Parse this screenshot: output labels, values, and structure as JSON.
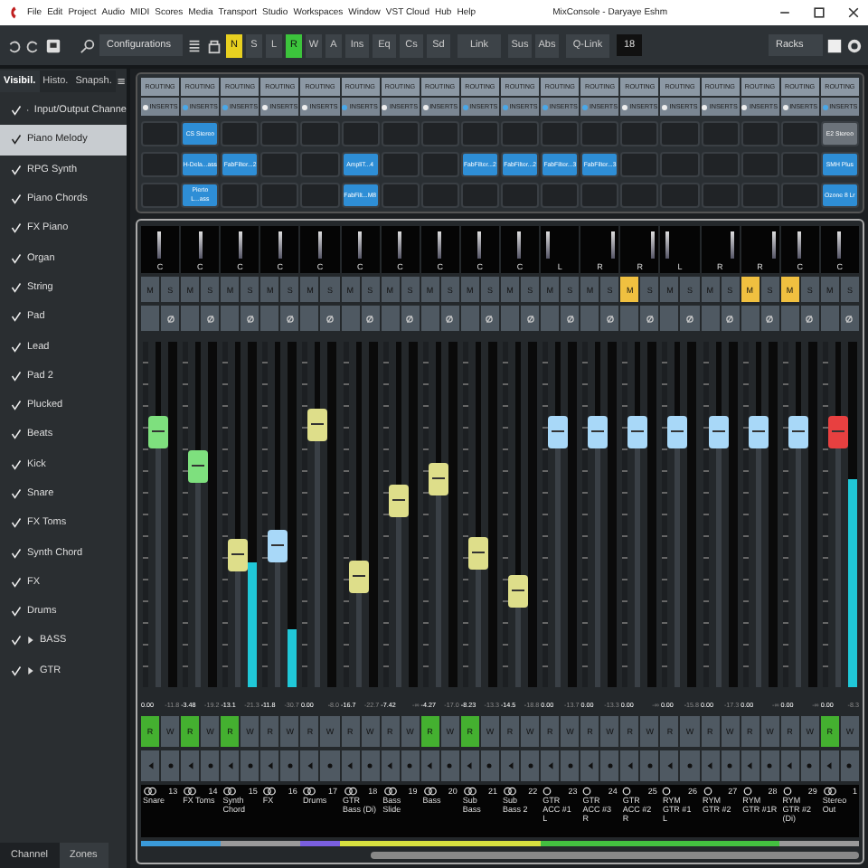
{
  "menu": {
    "items": [
      "File",
      "Edit",
      "Project",
      "Audio",
      "MIDI",
      "Scores",
      "Media",
      "Transport",
      "Studio",
      "Workspaces",
      "Window",
      "VST Cloud",
      "Hub",
      "Help"
    ],
    "title": "MixConsole - Daryaye Eshm"
  },
  "toolbar": {
    "configurations": "Configurations",
    "states": [
      {
        "label": "N",
        "on": true,
        "color": "#e8d020"
      },
      {
        "label": "S",
        "on": false
      },
      {
        "label": "L",
        "on": false
      },
      {
        "label": "R",
        "on": true,
        "color": "#3cc43c"
      },
      {
        "label": "W",
        "on": false
      },
      {
        "label": "A",
        "on": false
      }
    ],
    "sections": [
      "Ins",
      "Eq",
      "Cs",
      "Sd"
    ],
    "link": "Link",
    "modes": [
      "Sus",
      "Abs"
    ],
    "qlink": "Q-Link",
    "count": "18",
    "racks": "Racks"
  },
  "sidebar": {
    "tabs": [
      {
        "label": "Visibil.",
        "selected": true
      },
      {
        "label": "Histo.",
        "selected": false
      },
      {
        "label": "Snapsh.",
        "selected": false
      }
    ],
    "items": [
      {
        "label": "Input/Output Channe",
        "checked": true,
        "selected": false,
        "kind": "folder"
      },
      {
        "label": "Piano Melody",
        "checked": true,
        "selected": true,
        "kind": "track"
      },
      {
        "label": "RPG Synth",
        "checked": true,
        "selected": false,
        "kind": "track"
      },
      {
        "label": "Piano Chords",
        "checked": true,
        "selected": false,
        "kind": "track"
      },
      {
        "label": "FX Piano",
        "checked": true,
        "selected": false,
        "kind": "track"
      },
      {
        "label": "Organ",
        "checked": true,
        "selected": false,
        "kind": "track"
      },
      {
        "label": "String",
        "checked": true,
        "selected": false,
        "kind": "track"
      },
      {
        "label": "Pad",
        "checked": true,
        "selected": false,
        "kind": "track"
      },
      {
        "label": "Lead",
        "checked": true,
        "selected": false,
        "kind": "track"
      },
      {
        "label": "Pad 2",
        "checked": true,
        "selected": false,
        "kind": "track"
      },
      {
        "label": "Plucked",
        "checked": true,
        "selected": false,
        "kind": "track"
      },
      {
        "label": "Beats",
        "checked": true,
        "selected": false,
        "kind": "track"
      },
      {
        "label": "Kick",
        "checked": true,
        "selected": false,
        "kind": "track"
      },
      {
        "label": "Snare",
        "checked": true,
        "selected": false,
        "kind": "track"
      },
      {
        "label": "FX Toms",
        "checked": true,
        "selected": false,
        "kind": "track"
      },
      {
        "label": "Synth Chord",
        "checked": true,
        "selected": false,
        "kind": "track"
      },
      {
        "label": "FX",
        "checked": true,
        "selected": false,
        "kind": "track"
      },
      {
        "label": "Drums",
        "checked": true,
        "selected": false,
        "kind": "track"
      },
      {
        "label": "BASS",
        "checked": true,
        "selected": false,
        "kind": "folder"
      },
      {
        "label": "GTR",
        "checked": true,
        "selected": false,
        "kind": "folder"
      }
    ],
    "bottom_tabs": [
      {
        "label": "Channel",
        "selected": false
      },
      {
        "label": "Zones",
        "selected": true
      }
    ]
  },
  "channels": [
    {
      "routing": "ROUTING",
      "inserts_label": "INSERTS",
      "inserts": [
        {
          "kind": "empty"
        },
        {
          "kind": "empty"
        },
        {
          "kind": "empty"
        }
      ],
      "pan": {
        "label": "C",
        "kind": "center"
      },
      "mute": {
        "label": "M",
        "on": false
      },
      "solo": {
        "label": "S"
      },
      "read": {
        "label": "R",
        "on": true
      },
      "write": {
        "label": "W"
      },
      "fader": {
        "level": 0.74,
        "color": "#7ee07e"
      },
      "value": "0.00",
      "peak": "-11.8",
      "stereo": true,
      "number": "13",
      "name": "Snare",
      "color": "#3a9ad9"
    },
    {
      "routing": "ROUTING",
      "inserts_label": "INSERTS",
      "inserts": [
        {
          "kind": "plugin",
          "name": "CS Stereo",
          "bypassed": false
        },
        {
          "kind": "plugin",
          "name": "H-Dela...ass",
          "bypassed": false
        },
        {
          "kind": "plugin",
          "name": "Pierto L...ass",
          "bypassed": false
        }
      ],
      "pan": {
        "label": "C",
        "kind": "center"
      },
      "mute": {
        "label": "M",
        "on": false
      },
      "solo": {
        "label": "S"
      },
      "read": {
        "label": "R",
        "on": true
      },
      "write": {
        "label": "W"
      },
      "fader": {
        "level": 0.64,
        "color": "#7ee07e"
      },
      "value": "-3.48",
      "peak": "-19.2",
      "stereo": true,
      "number": "14",
      "name": "FX Toms",
      "color": "#3a9ad9"
    },
    {
      "routing": "ROUTING",
      "inserts_label": "INSERTS",
      "inserts": [
        {
          "kind": "empty"
        },
        {
          "kind": "plugin",
          "name": "FabFilter...2",
          "bypassed": false
        },
        {
          "kind": "empty"
        }
      ],
      "pan": {
        "label": "C",
        "kind": "center"
      },
      "mute": {
        "label": "M",
        "on": false
      },
      "solo": {
        "label": "S"
      },
      "read": {
        "label": "R",
        "on": true
      },
      "write": {
        "label": "W"
      },
      "fader": {
        "level": 0.38,
        "color": "#dede8a"
      },
      "meter": {
        "level": 0.36
      },
      "value": "-13.1",
      "peak": "-21.3",
      "stereo": true,
      "number": "15",
      "name": "Synth Chord",
      "color": "#9a9a9a"
    },
    {
      "routing": "ROUTING",
      "inserts_label": "INSERTS",
      "inserts": [
        {
          "kind": "empty"
        },
        {
          "kind": "empty"
        },
        {
          "kind": "empty"
        }
      ],
      "pan": {
        "label": "C",
        "kind": "center"
      },
      "mute": {
        "label": "M",
        "on": false
      },
      "solo": {
        "label": "S"
      },
      "read": {
        "label": "R",
        "on": false
      },
      "write": {
        "label": "W"
      },
      "fader": {
        "level": 0.41,
        "color": "#a8d8f8"
      },
      "meter": {
        "level": 0.17
      },
      "value": "-11.8",
      "peak": "-30.7",
      "stereo": true,
      "number": "16",
      "name": "FX",
      "color": "#9a9a9a"
    },
    {
      "routing": "ROUTING",
      "inserts_label": "INSERTS",
      "inserts": [
        {
          "kind": "empty"
        },
        {
          "kind": "empty"
        },
        {
          "kind": "empty"
        }
      ],
      "pan": {
        "label": "C",
        "kind": "center"
      },
      "mute": {
        "label": "M",
        "on": false
      },
      "solo": {
        "label": "S"
      },
      "read": {
        "label": "R",
        "on": false
      },
      "write": {
        "label": "W"
      },
      "fader": {
        "level": 0.76,
        "color": "#dede8a"
      },
      "value": "0.00",
      "peak": "-8.0",
      "stereo": true,
      "number": "17",
      "name": "Drums",
      "color": "#7a5fe0"
    },
    {
      "routing": "ROUTING",
      "inserts_label": "INSERTS",
      "inserts": [
        {
          "kind": "empty"
        },
        {
          "kind": "plugin",
          "name": "AmpliT...4",
          "bypassed": false
        },
        {
          "kind": "plugin",
          "name": "FabFilt...M8",
          "bypassed": false
        }
      ],
      "pan": {
        "label": "C",
        "kind": "center"
      },
      "mute": {
        "label": "M",
        "on": false
      },
      "solo": {
        "label": "S"
      },
      "read": {
        "label": "R",
        "on": false
      },
      "write": {
        "label": "W"
      },
      "fader": {
        "level": 0.32,
        "color": "#dede8a"
      },
      "value": "-16.7",
      "peak": "-22.7",
      "stereo": true,
      "number": "18",
      "name": "GTR Bass (Di)",
      "color": "#d8e040"
    },
    {
      "routing": "ROUTING",
      "inserts_label": "INSERTS",
      "inserts": [
        {
          "kind": "empty"
        },
        {
          "kind": "empty"
        },
        {
          "kind": "empty"
        }
      ],
      "pan": {
        "label": "C",
        "kind": "center"
      },
      "mute": {
        "label": "M",
        "on": false
      },
      "solo": {
        "label": "S"
      },
      "read": {
        "label": "R",
        "on": false
      },
      "write": {
        "label": "W"
      },
      "fader": {
        "level": 0.54,
        "color": "#dede8a"
      },
      "value": "-7.42",
      "peak": "-∞",
      "stereo": true,
      "number": "19",
      "name": "Bass Slide",
      "color": "#d8e040"
    },
    {
      "routing": "ROUTING",
      "inserts_label": "INSERTS",
      "inserts": [
        {
          "kind": "empty"
        },
        {
          "kind": "empty"
        },
        {
          "kind": "empty"
        }
      ],
      "pan": {
        "label": "C",
        "kind": "center"
      },
      "mute": {
        "label": "M",
        "on": false
      },
      "solo": {
        "label": "S"
      },
      "read": {
        "label": "R",
        "on": true
      },
      "write": {
        "label": "W"
      },
      "fader": {
        "level": 0.6,
        "color": "#dede8a"
      },
      "value": "-4.27",
      "peak": "-17.0",
      "stereo": true,
      "number": "20",
      "name": "Bass",
      "color": "#d8e040"
    },
    {
      "routing": "ROUTING",
      "inserts_label": "INSERTS",
      "inserts": [
        {
          "kind": "empty"
        },
        {
          "kind": "plugin",
          "name": "FabFilter...2",
          "bypassed": false
        },
        {
          "kind": "empty"
        }
      ],
      "pan": {
        "label": "C",
        "kind": "center"
      },
      "mute": {
        "label": "M",
        "on": false
      },
      "solo": {
        "label": "S"
      },
      "read": {
        "label": "R",
        "on": true
      },
      "write": {
        "label": "W"
      },
      "fader": {
        "level": 0.39,
        "color": "#dede8a"
      },
      "value": "-8.23",
      "peak": "-13.3",
      "stereo": true,
      "number": "21",
      "name": "Sub Bass",
      "color": "#d8e040"
    },
    {
      "routing": "ROUTING",
      "inserts_label": "INSERTS",
      "inserts": [
        {
          "kind": "empty"
        },
        {
          "kind": "plugin",
          "name": "FabFilter...2",
          "bypassed": false
        },
        {
          "kind": "empty"
        }
      ],
      "pan": {
        "label": "C",
        "kind": "center"
      },
      "mute": {
        "label": "M",
        "on": false
      },
      "solo": {
        "label": "S"
      },
      "read": {
        "label": "R",
        "on": false
      },
      "write": {
        "label": "W"
      },
      "fader": {
        "level": 0.28,
        "color": "#dede8a"
      },
      "value": "-14.5",
      "peak": "-18.8",
      "stereo": true,
      "number": "22",
      "name": "Sub Bass 2",
      "color": "#d8e040"
    },
    {
      "routing": "ROUTING",
      "inserts_label": "INSERTS",
      "inserts": [
        {
          "kind": "empty"
        },
        {
          "kind": "plugin",
          "name": "FabFilter...3",
          "bypassed": false
        },
        {
          "kind": "empty"
        }
      ],
      "pan": {
        "label": "L",
        "kind": "left"
      },
      "mute": {
        "label": "M",
        "on": false
      },
      "solo": {
        "label": "S"
      },
      "read": {
        "label": "R",
        "on": false
      },
      "write": {
        "label": "W"
      },
      "fader": {
        "level": 0.74,
        "color": "#a8d8f8"
      },
      "value": "0.00",
      "peak": "-13.7",
      "stereo": false,
      "number": "23",
      "name": "GTR ACC #1 L",
      "color": "#44c040"
    },
    {
      "routing": "ROUTING",
      "inserts_label": "INSERTS",
      "inserts": [
        {
          "kind": "empty"
        },
        {
          "kind": "plugin",
          "name": "FabFilter...3",
          "bypassed": false
        },
        {
          "kind": "empty"
        }
      ],
      "pan": {
        "label": "R",
        "kind": "right"
      },
      "mute": {
        "label": "M",
        "on": false
      },
      "solo": {
        "label": "S"
      },
      "read": {
        "label": "R",
        "on": false
      },
      "write": {
        "label": "W"
      },
      "fader": {
        "level": 0.74,
        "color": "#a8d8f8"
      },
      "value": "0.00",
      "peak": "-13.3",
      "stereo": false,
      "number": "24",
      "name": "GTR ACC #3 R",
      "color": "#44c040"
    },
    {
      "routing": "ROUTING",
      "inserts_label": "INSERTS",
      "inserts": [
        {
          "kind": "empty"
        },
        {
          "kind": "empty"
        },
        {
          "kind": "empty"
        }
      ],
      "pan": {
        "label": "R",
        "kind": "right"
      },
      "mute": {
        "label": "M",
        "on": true
      },
      "solo": {
        "label": "S"
      },
      "read": {
        "label": "R",
        "on": false
      },
      "write": {
        "label": "W"
      },
      "fader": {
        "level": 0.74,
        "color": "#a8d8f8"
      },
      "value": "0.00",
      "peak": "-∞",
      "stereo": false,
      "number": "25",
      "name": "GTR ACC #2 R",
      "color": "#44c040"
    },
    {
      "routing": "ROUTING",
      "inserts_label": "INSERTS",
      "inserts": [
        {
          "kind": "empty"
        },
        {
          "kind": "empty"
        },
        {
          "kind": "empty"
        }
      ],
      "pan": {
        "label": "L",
        "kind": "left"
      },
      "mute": {
        "label": "M",
        "on": false
      },
      "solo": {
        "label": "S"
      },
      "read": {
        "label": "R",
        "on": false
      },
      "write": {
        "label": "W"
      },
      "fader": {
        "level": 0.74,
        "color": "#a8d8f8"
      },
      "value": "0.00",
      "peak": "-15.8",
      "stereo": false,
      "number": "26",
      "name": "RYM GTR #1 L",
      "color": "#44c040"
    },
    {
      "routing": "ROUTING",
      "inserts_label": "INSERTS",
      "inserts": [
        {
          "kind": "empty"
        },
        {
          "kind": "empty"
        },
        {
          "kind": "empty"
        }
      ],
      "pan": {
        "label": "R",
        "kind": "right"
      },
      "mute": {
        "label": "M",
        "on": false
      },
      "solo": {
        "label": "S"
      },
      "read": {
        "label": "R",
        "on": false
      },
      "write": {
        "label": "W"
      },
      "fader": {
        "level": 0.74,
        "color": "#a8d8f8"
      },
      "value": "0.00",
      "peak": "-17.3",
      "stereo": false,
      "number": "27",
      "name": "RYM GTR #2",
      "color": "#44c040"
    },
    {
      "routing": "ROUTING",
      "inserts_label": "INSERTS",
      "inserts": [
        {
          "kind": "empty"
        },
        {
          "kind": "empty"
        },
        {
          "kind": "empty"
        }
      ],
      "pan": {
        "label": "R",
        "kind": "right"
      },
      "mute": {
        "label": "M",
        "on": true
      },
      "solo": {
        "label": "S"
      },
      "read": {
        "label": "R",
        "on": false
      },
      "write": {
        "label": "W"
      },
      "fader": {
        "level": 0.74,
        "color": "#a8d8f8"
      },
      "value": "0.00",
      "peak": "-∞",
      "stereo": false,
      "number": "28",
      "name": "RYM GTR #1R",
      "color": "#44c040"
    },
    {
      "routing": "ROUTING",
      "inserts_label": "INSERTS",
      "inserts": [
        {
          "kind": "empty"
        },
        {
          "kind": "empty"
        },
        {
          "kind": "empty"
        }
      ],
      "pan": {
        "label": "C",
        "kind": "center"
      },
      "mute": {
        "label": "M",
        "on": true
      },
      "solo": {
        "label": "S"
      },
      "read": {
        "label": "R",
        "on": false
      },
      "write": {
        "label": "W"
      },
      "fader": {
        "level": 0.74,
        "color": "#a8d8f8"
      },
      "value": "0.00",
      "peak": "-∞",
      "stereo": false,
      "number": "29",
      "name": "RYM GTR #2 (Di)",
      "color": "#9a9a9a"
    },
    {
      "routing": "ROUTING",
      "inserts_label": "INSERTS",
      "inserts": [
        {
          "kind": "plugin",
          "name": "E2 Stereo",
          "bypassed": true
        },
        {
          "kind": "plugin",
          "name": "SMH Plus",
          "bypassed": false
        },
        {
          "kind": "plugin",
          "name": "Ozone 8 Lr",
          "bypassed": false
        }
      ],
      "pan": {
        "label": "C",
        "kind": "center"
      },
      "mute": {
        "label": "M",
        "on": false
      },
      "solo": {
        "label": "S"
      },
      "read": {
        "label": "R",
        "on": true
      },
      "write": {
        "label": "W"
      },
      "fader": {
        "level": 0.74,
        "color": "#e84040"
      },
      "meter": {
        "level": 0.6
      },
      "value": "0.00",
      "peak": "-8.3",
      "stereo": true,
      "number": "1",
      "name": "Stereo Out",
      "color": "#9a9a9a"
    }
  ]
}
